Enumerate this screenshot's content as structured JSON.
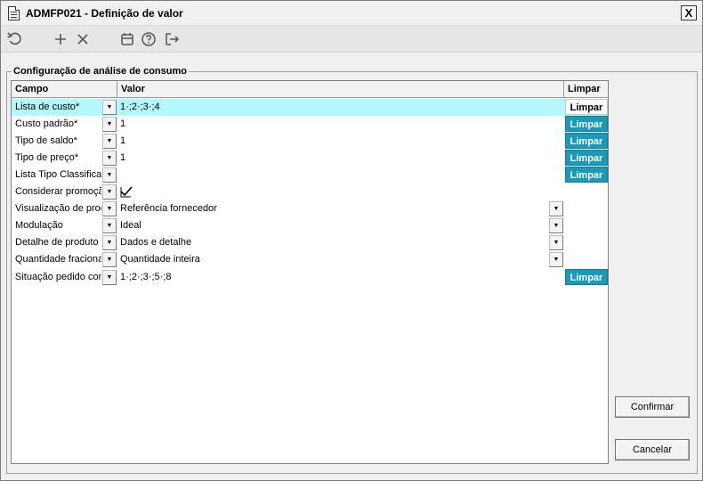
{
  "window": {
    "title": "ADMFP021 - Definição de valor",
    "close_label": "X"
  },
  "toolbar": {
    "icons": [
      "refresh-icon",
      "add-icon",
      "delete-icon",
      "calendar-icon",
      "help-icon",
      "exit-icon"
    ]
  },
  "group": {
    "label": "Configuração de análise de consumo"
  },
  "grid": {
    "columns": {
      "campo": "Campo",
      "valor": "Valor",
      "limpar": "Limpar"
    },
    "rows": [
      {
        "campo": "Lista de custo*",
        "valor": "1·;2·;3·;4",
        "limpar": "Limpar",
        "selected": true
      },
      {
        "campo": "Custo padrão*",
        "valor": "1",
        "limpar": "Limpar"
      },
      {
        "campo": "Tipo de saldo*",
        "valor": "1",
        "limpar": "Limpar"
      },
      {
        "campo": "Tipo de preço*",
        "valor": "1",
        "limpar": "Limpar"
      },
      {
        "campo": "Lista Tipo Classificação",
        "valor": "",
        "limpar": "Limpar"
      },
      {
        "campo": "Considerar promoção",
        "valor": "",
        "checked": true
      },
      {
        "campo": "Visualização de produto",
        "valor": "Referência fornecedor",
        "dropdown": true
      },
      {
        "campo": "Modulação",
        "valor": "Ideal",
        "dropdown": true
      },
      {
        "campo": "Detalhe de produto",
        "valor": "Dados e detalhe",
        "dropdown": true
      },
      {
        "campo": "Quantidade fracionada",
        "valor": "Quantidade inteira",
        "dropdown": true
      },
      {
        "campo": "Situação pedido compra",
        "valor": "1·;2·;3·;5·;8",
        "limpar": "Limpar"
      }
    ]
  },
  "buttons": {
    "confirm": "Confirmar",
    "cancel": "Cancelar"
  },
  "colors": {
    "selected_row": "#b3f9fb",
    "limpar_button": "#1a9ab8"
  }
}
